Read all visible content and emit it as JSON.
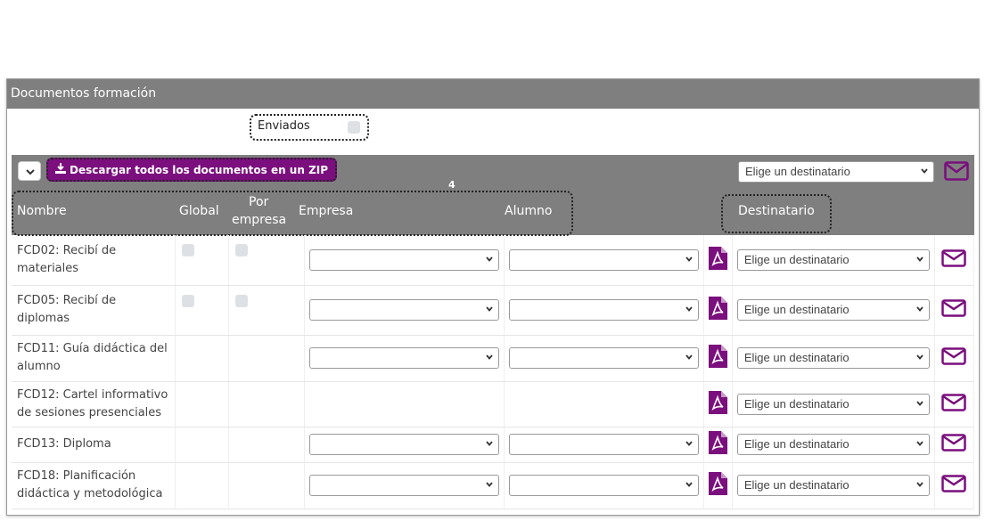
{
  "panel": {
    "title": "Documentos formación"
  },
  "filter": {
    "enviados_label": "Enviados"
  },
  "toolbar": {
    "zip_label": "Descargar todos los documentos en un ZIP",
    "dest_placeholder": "Elige un destinatario",
    "badge": "4"
  },
  "columns": {
    "nombre": "Nombre",
    "global": "Global",
    "por_empresa_1": "Por",
    "por_empresa_2": "empresa",
    "empresa": "Empresa",
    "alumno": "Alumno",
    "destinatario": "Destinatario"
  },
  "rows": [
    {
      "line1": "FCD02: Recibí de",
      "line2": "materiales",
      "has_checks": true,
      "has_selects": true,
      "dest": "Elige un destinatario"
    },
    {
      "line1": "FCD05: Recibí de",
      "line2": "diplomas",
      "has_checks": true,
      "has_selects": true,
      "dest": "Elige un destinatario"
    },
    {
      "line1": "FCD11: Guía didáctica del",
      "line2": "alumno",
      "has_checks": false,
      "has_selects": true,
      "dest": "Elige un destinatario"
    },
    {
      "line1": "FCD12: Cartel informativo",
      "line2": "de sesiones presenciales",
      "has_checks": false,
      "has_selects": false,
      "dest": "Elige un destinatario"
    },
    {
      "line1": "FCD13: Diploma",
      "line2": "",
      "has_checks": false,
      "has_selects": true,
      "dest": "Elige un destinatario"
    },
    {
      "line1": "FCD18: Planificación",
      "line2": "didáctica y metodológica",
      "has_checks": false,
      "has_selects": true,
      "dest": "Elige un destinatario"
    }
  ],
  "colors": {
    "accent": "#7a0f7d",
    "header_bg": "#7f7f7f"
  }
}
